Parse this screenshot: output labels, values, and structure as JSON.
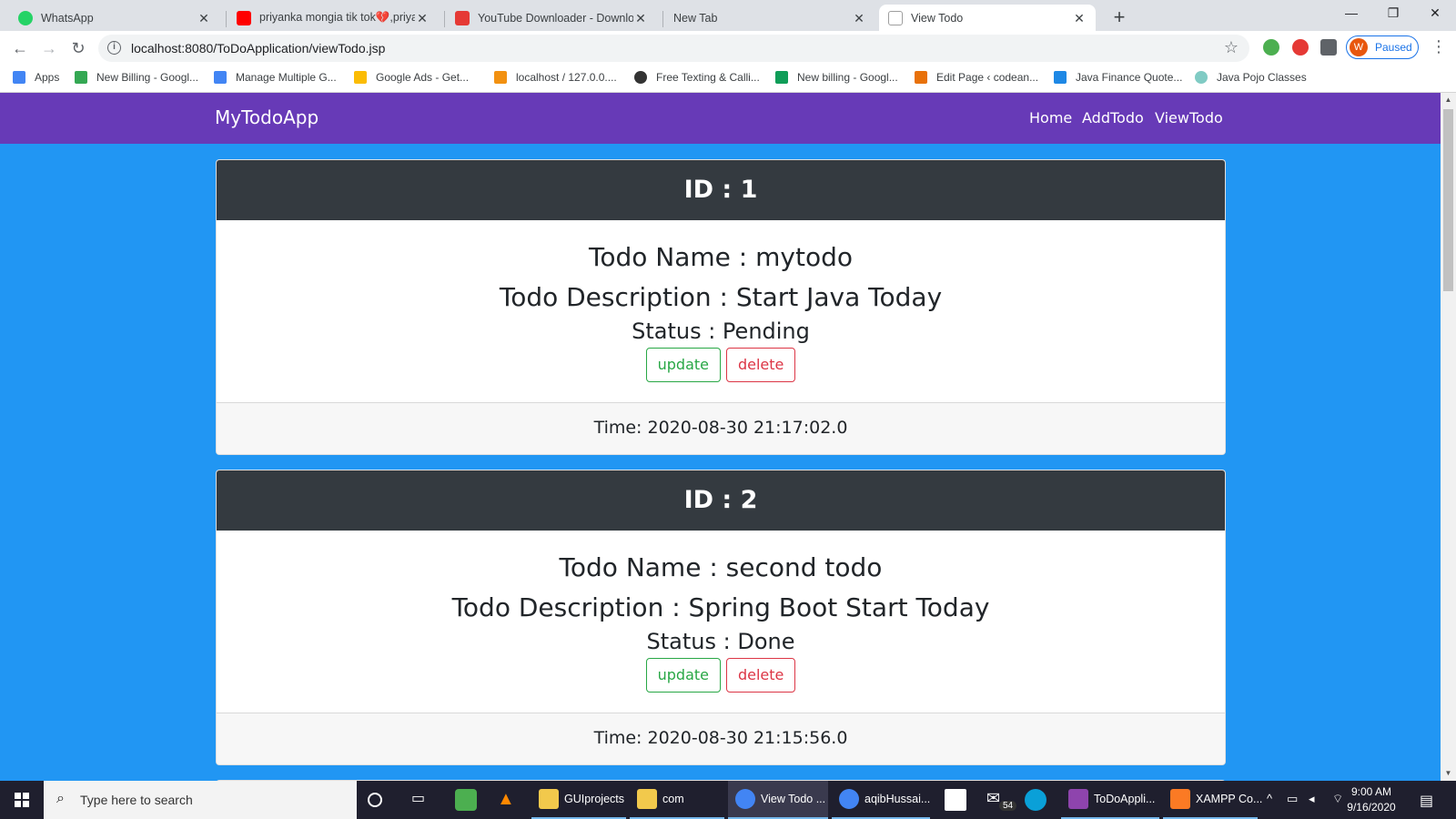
{
  "browser": {
    "tabs": [
      {
        "label": "WhatsApp",
        "favicon_color": "#25d366"
      },
      {
        "label": "priyanka mongia tik tok💔,priyan",
        "favicon_color": "#ff0000"
      },
      {
        "label": "YouTube Downloader - Downloa",
        "favicon_color": "#e53935"
      },
      {
        "label": "New Tab",
        "favicon_color": ""
      },
      {
        "label": "View Todo",
        "favicon_color": "#9e9e9e"
      }
    ],
    "active_tab": 4,
    "url": "localhost:8080/ToDoApplication/viewTodo.jsp",
    "profile_initial": "W",
    "profile_status": "Paused",
    "bookmarks": [
      {
        "label": "Apps",
        "icon_color": "#4285f4"
      },
      {
        "label": "New Billing - Googl...",
        "icon_color": "#34a853"
      },
      {
        "label": "Manage Multiple G...",
        "icon_color": "#4285f4"
      },
      {
        "label": "Google Ads - Get...",
        "icon_color": "#fbbc04"
      },
      {
        "label": "localhost / 127.0.0....",
        "icon_color": "#f29111"
      },
      {
        "label": "Free Texting & Calli...",
        "icon_color": "#333333"
      },
      {
        "label": "New billing - Googl...",
        "icon_color": "#0f9d58"
      },
      {
        "label": "Edit Page ‹ codean...",
        "icon_color": "#e8710a"
      },
      {
        "label": "Java Finance Quote...",
        "icon_color": "#1e88e5"
      },
      {
        "label": "Java Pojo Classes",
        "icon_color": "#80cbc4"
      }
    ]
  },
  "app": {
    "brand": "MyTodoApp",
    "nav": [
      "Home",
      "AddTodo",
      "ViewTodo"
    ],
    "nav_color": "#673ab7",
    "page_bg": "#2196f3",
    "todos": [
      {
        "id_label": "ID : 1",
        "name": "Todo Name : mytodo",
        "description": "Todo Description : Start Java Today",
        "status": "Status : Pending",
        "update_label": "update",
        "delete_label": "delete",
        "time": "Time: 2020-08-30 21:17:02.0"
      },
      {
        "id_label": "ID : 2",
        "name": "Todo Name : second todo",
        "description": "Todo Description : Spring Boot Start Today",
        "status": "Status : Done",
        "update_label": "update",
        "delete_label": "delete",
        "time": "Time: 2020-08-30 21:15:56.0"
      }
    ]
  },
  "taskbar": {
    "search_placeholder": "Type here to search",
    "apps": [
      {
        "label": "GUIprojects",
        "icon_color": "#f2c94c"
      },
      {
        "label": "com",
        "icon_color": "#f2c94c"
      },
      {
        "label": "View Todo ...",
        "icon_color": "#4285f4"
      },
      {
        "label": "aqibHussai...",
        "icon_color": "#4285f4"
      },
      {
        "label": "ToDoAppli...",
        "icon_color": "#8e44ad"
      },
      {
        "label": "XAMPP Co...",
        "icon_color": "#fb7a24"
      }
    ],
    "mail_badge": "54",
    "time": "9:00 AM",
    "date": "9/16/2020"
  }
}
